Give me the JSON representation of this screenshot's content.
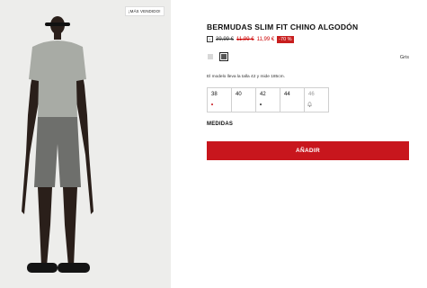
{
  "product": {
    "badge": "¡MÁS VENDIDO!",
    "title": "BERMUDAS SLIM FIT CHINO ALGODÓN",
    "info_icon": "i",
    "price_original": "39,99 €",
    "price_previous": "11,99 €",
    "price_current": "11,99 €",
    "discount": "-70 %",
    "color_name": "Gris",
    "model_info": "El modelo lleva la talla 42 y mide 185cm.",
    "sizes": [
      {
        "label": "38",
        "status": "low-stock"
      },
      {
        "label": "40",
        "status": "available"
      },
      {
        "label": "42",
        "status": "low-stock"
      },
      {
        "label": "44",
        "status": "available"
      },
      {
        "label": "46",
        "status": "notify"
      }
    ],
    "measures_label": "MEDIDAS",
    "add_button": "AÑADIR"
  },
  "colors": {
    "accent": "#c8161d",
    "swatch_light": "#d8d8d8",
    "swatch_dark": "#555555",
    "low_stock_dot_red": "#c8161d",
    "low_stock_dot_dark": "#333333"
  },
  "icons": {
    "info": "info-icon",
    "bell": "bell-icon"
  }
}
